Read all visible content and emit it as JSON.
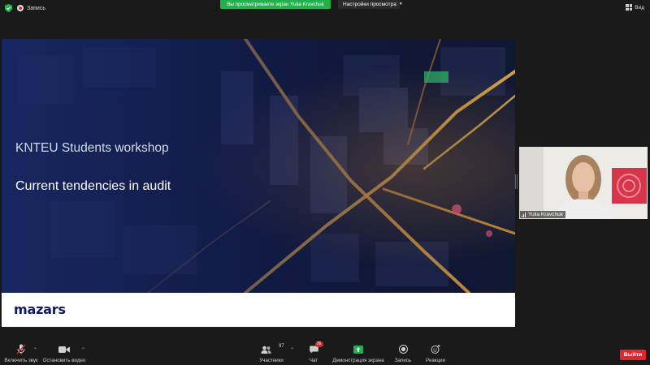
{
  "topbar": {
    "recording_label": "Запись",
    "share_banner": "Вы просматриваете экран Yulia Kravchuk",
    "view_options": "Настройки просмотра",
    "view_button": "Вид",
    "colors": {
      "banner": "#23b14d",
      "shield": "#23b14d"
    }
  },
  "slide": {
    "title": "KNTEU Students workshop",
    "subtitle": "Current tendencies in audit",
    "logo": "mazars"
  },
  "video": {
    "participant_name": "Yulia Kravchuk"
  },
  "toolbar": {
    "audio": {
      "label": "Включить звук",
      "icon": "muted-microphone-icon"
    },
    "video": {
      "label": "Остановить видео",
      "icon": "video-camera-icon"
    },
    "participants": {
      "label": "Участники",
      "count": "97",
      "icon": "participants-icon"
    },
    "chat": {
      "label": "Чат",
      "badge": "26",
      "icon": "chat-icon"
    },
    "share": {
      "label": "Демонстрация экрана",
      "icon": "share-screen-icon",
      "color": "#23b14d"
    },
    "record": {
      "label": "Запись",
      "icon": "record-icon"
    },
    "reactions": {
      "label": "Реакции",
      "icon": "reactions-icon"
    },
    "leave": {
      "label": "Выйти",
      "color": "#e0262f"
    }
  }
}
